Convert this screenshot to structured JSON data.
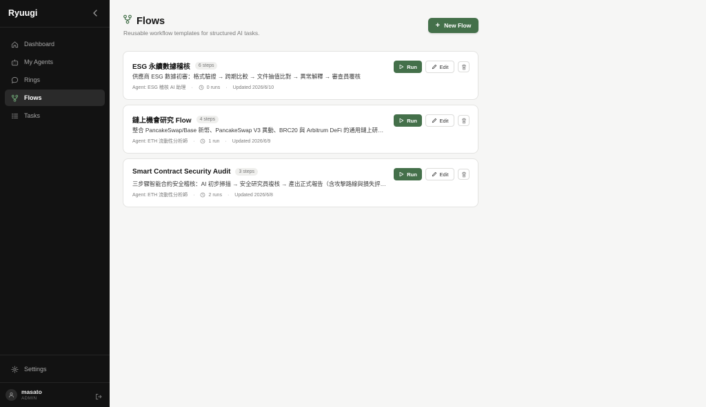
{
  "sidebar": {
    "brand": "Ryuugi",
    "nav": [
      {
        "label": "Dashboard",
        "icon": "home-icon",
        "active": false
      },
      {
        "label": "My Agents",
        "icon": "bot-icon",
        "active": false
      },
      {
        "label": "Rings",
        "icon": "chat-bubble-icon",
        "active": false
      },
      {
        "label": "Flows",
        "icon": "workflow-icon",
        "active": true
      },
      {
        "label": "Tasks",
        "icon": "list-icon",
        "active": false
      }
    ],
    "settings_label": "Settings",
    "user": {
      "name": "masato",
      "role": "ADMIN"
    }
  },
  "header": {
    "title": "Flows",
    "subtitle": "Reusable workflow templates for structured AI tasks.",
    "new_flow_label": "New Flow"
  },
  "flows": [
    {
      "name": "ESG 永續數據稽核",
      "steps": "6 steps",
      "description": "供應商 ESG 數據初審：格式驗證 → 跨期比較 → 文件抽值比對 → 異常解釋 → 審查員覆核",
      "agent": "Agent: ESG 稽核 AI 助理",
      "runs": "0 runs",
      "updated": "Updated 2026/6/10"
    },
    {
      "name": "鏈上機會研究 Flow",
      "steps": "4 steps",
      "description": "整合 PancakeSwap/Base 新幣、PancakeSwap V3 異動、BRC20 與 Arbitrum DeFi 的通用鏈上研究流程",
      "agent": "Agent: ETH 流動性分析師",
      "runs": "1 run",
      "updated": "Updated 2026/6/9"
    },
    {
      "name": "Smart Contract Security Audit",
      "steps": "3 steps",
      "description": "三步驟智能合約安全稽核：AI 初步掃描 → 安全研究員複核 → 產出正式報告（含攻擊路線與損失評估）",
      "agent": "Agent: ETH 流動性分析師",
      "runs": "2 runs",
      "updated": "Updated 2026/6/8"
    }
  ],
  "actions": {
    "run_label": "Run",
    "edit_label": "Edit"
  },
  "colors": {
    "accent": "#44704a",
    "sidebar_bg": "#121212",
    "page_bg": "#f6f6f5"
  }
}
